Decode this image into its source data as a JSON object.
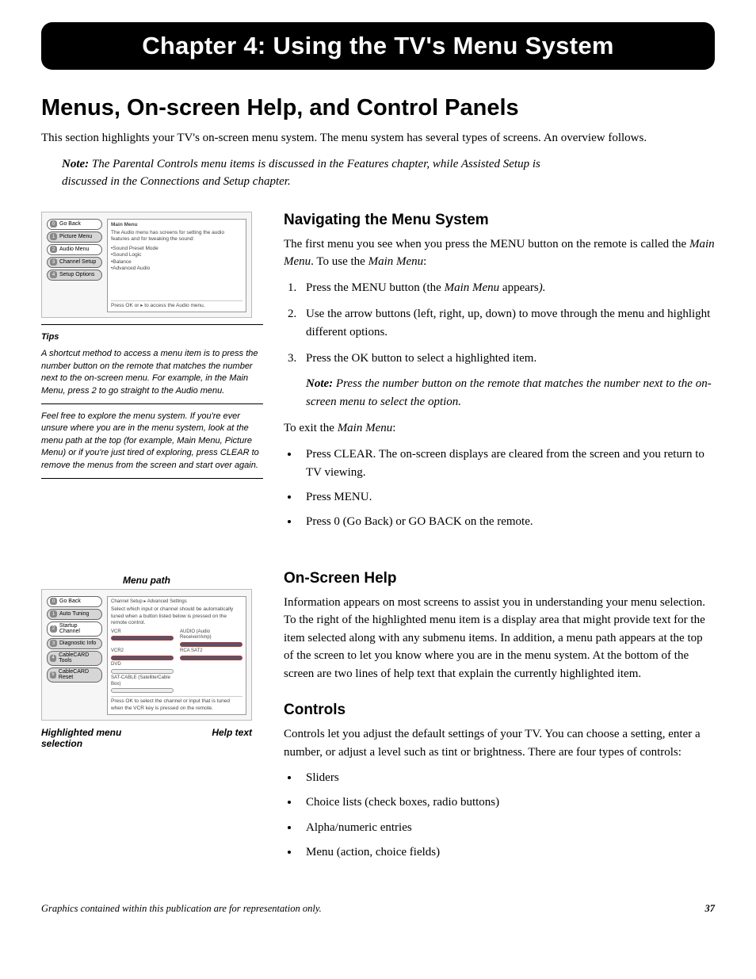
{
  "chapter_bar": "Chapter 4: Using the TV's Menu System",
  "section_title": "Menus, On-screen Help, and Control Panels",
  "intro": "This section highlights your TV's on-screen menu system. The menu system has several types of screens. An overview follows.",
  "note_label": "Note:",
  "note_body": " The Parental Controls menu items is discussed in the Features chapter, while Assisted Setup is discussed in the Connections and Setup chapter.",
  "tips": {
    "heading": "Tips",
    "para1": "A shortcut method to access a menu item is to press the number button on the remote that matches the number next to the on-screen menu. For example, in the Main Menu, press 2 to go straight to the Audio menu.",
    "para2": "Feel free to explore the menu system. If you're ever unsure where you are in the menu system,  look at the menu path at the top (for example, Main Menu, Picture Menu) or if you're just tired of exploring, press CLEAR to remove the menus from the screen and start over again."
  },
  "nav": {
    "title": "Navigating the Menu System",
    "intro_a": "The first menu you see when you press the MENU button on the remote is called the ",
    "intro_b": "Main Menu",
    "intro_c": ". To use the ",
    "intro_d": "Main Menu",
    "intro_e": ":",
    "step1_a": "Press the MENU button (the ",
    "step1_b": "Main Menu",
    "step1_c": " appears",
    "step1_d": ").",
    "step2": "Use the arrow buttons (left, right, up, down) to move through the menu and highlight different options.",
    "step3": "Press the OK button to select a highlighted item.",
    "step3_note_label": "Note:",
    "step3_note": " Press the number button on the remote that matches the number next to the on-screen menu to select the option.",
    "exit_a": "To exit the ",
    "exit_b": "Main Menu",
    "exit_c": ":",
    "b1": "Press CLEAR. The on-screen displays are cleared from the screen and you return to TV viewing.",
    "b2": "Press MENU.",
    "b3": "Press 0 (Go Back) or GO BACK on the remote."
  },
  "shot1": {
    "items": [
      {
        "n": "0",
        "label": "Go Back"
      },
      {
        "n": "1",
        "label": "Picture Menu"
      },
      {
        "n": "2",
        "label": "Audio Menu"
      },
      {
        "n": "3",
        "label": "Channel Setup"
      },
      {
        "n": "4",
        "label": "Setup Options"
      }
    ],
    "header": "Main Menu",
    "sub": "The Audio menu has screens for setting the audio features and for tweaking the sound:",
    "features": [
      "•Sound Preset Mode",
      "•Sound Logic",
      "•Balance",
      "•Advanced Audio"
    ],
    "footer": "Press OK or ▸ to access the Audio menu."
  },
  "callouts": {
    "menu_path": "Menu path",
    "highlighted": "Highlighted menu selection",
    "help_text": "Help text"
  },
  "shot2": {
    "items": [
      {
        "n": "0",
        "label": "Go Back"
      },
      {
        "n": "1",
        "label": "Auto Tuning"
      },
      {
        "n": "2",
        "label": "Startup Channel"
      },
      {
        "n": "3",
        "label": "Diagnostic Info"
      },
      {
        "n": "4",
        "label": "CableCARD Tools"
      },
      {
        "n": "5",
        "label": "CableCARD Reset"
      }
    ],
    "path": "Channel Setup ▸ Advanced Settings",
    "sub": "Select which input or channel should be automatically tuned when a button listed below is pressed on the remote control.",
    "col1": [
      "VCR",
      "VCR2",
      "DVD",
      "SAT-CABLE (Satellite/Cable Box)"
    ],
    "col2": [
      "AUDIO (Audio Receiver/Amp)",
      "RCA SAT2"
    ],
    "footer": "Press OK to select the channel or input that is tuned when the VCR key is pressed on the remote."
  },
  "help": {
    "title": "On-Screen Help",
    "body": "Information appears on most screens to assist you in understanding your menu selection. To the right of the highlighted menu item is a display area that might provide text for the item selected along with any submenu items. In addition, a menu path appears at the top of the screen to let you know where you are in the menu system. At the bottom of the screen are two lines of help text that explain the currently highlighted item."
  },
  "controls": {
    "title": "Controls",
    "body": "Controls let you adjust the default settings of your TV. You can choose a setting, enter a number, or adjust a level such as tint or brightness. There are four types of controls:",
    "list": [
      "Sliders",
      "Choice lists (check boxes, radio buttons)",
      "Alpha/numeric entries",
      "Menu (action, choice fields)"
    ]
  },
  "footer": {
    "text": "Graphics contained within this publication are for representation only.",
    "page": "37"
  }
}
